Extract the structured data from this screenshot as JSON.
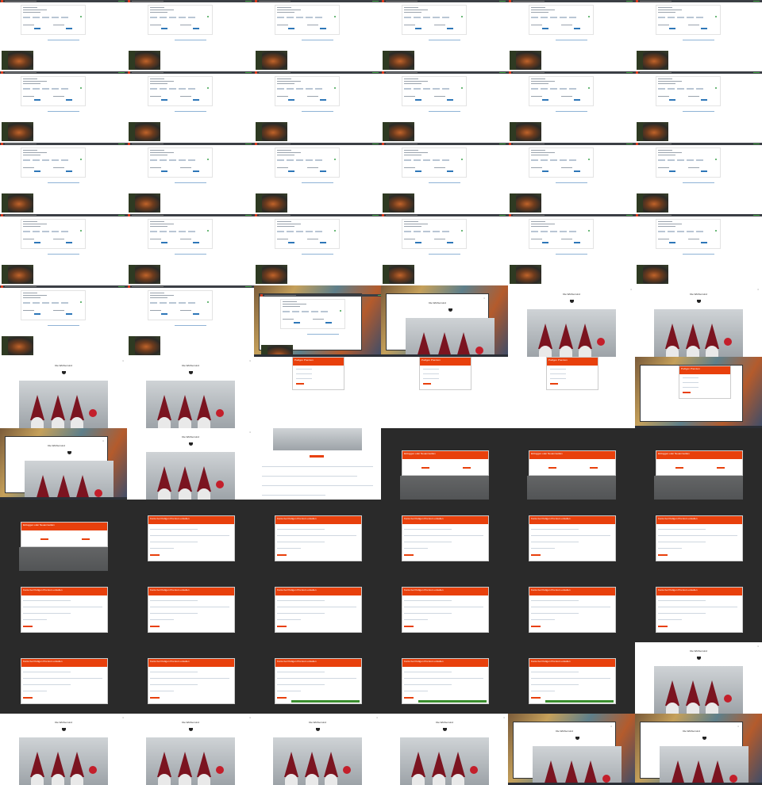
{
  "grid": {
    "cols": 6,
    "rows": 11
  },
  "labels": {
    "gnome_title": "Die Wichtel sind",
    "gnome_sub": "",
    "form_title": "Podigon Premium",
    "orange_header_1": "Einloggen oder Neuanmelden",
    "orange_header_2": "Konto bei Podigon Premium erstellen"
  },
  "colors": {
    "accent_orange": "#e8400c",
    "button_blue": "#2e77b8",
    "ok_green": "#3ea34f",
    "bar_dark": "#3b3f45",
    "bg_dark": "#2a2a2a"
  },
  "cells": [
    {
      "type": "form"
    },
    {
      "type": "form"
    },
    {
      "type": "form"
    },
    {
      "type": "form"
    },
    {
      "type": "form"
    },
    {
      "type": "form"
    },
    {
      "type": "form"
    },
    {
      "type": "form"
    },
    {
      "type": "form"
    },
    {
      "type": "form"
    },
    {
      "type": "form"
    },
    {
      "type": "form"
    },
    {
      "type": "form"
    },
    {
      "type": "form"
    },
    {
      "type": "form"
    },
    {
      "type": "form"
    },
    {
      "type": "form"
    },
    {
      "type": "form"
    },
    {
      "type": "form"
    },
    {
      "type": "form"
    },
    {
      "type": "form"
    },
    {
      "type": "form"
    },
    {
      "type": "form"
    },
    {
      "type": "form"
    },
    {
      "type": "form"
    },
    {
      "type": "form"
    },
    {
      "type": "desktop_form"
    },
    {
      "type": "desktop_gnome"
    },
    {
      "type": "gnome"
    },
    {
      "type": "gnome"
    },
    {
      "type": "gnome"
    },
    {
      "type": "gnome"
    },
    {
      "type": "login"
    },
    {
      "type": "login"
    },
    {
      "type": "login"
    },
    {
      "type": "desktop_login"
    },
    {
      "type": "desktop_gnome"
    },
    {
      "type": "gnome"
    },
    {
      "type": "podcast_page"
    },
    {
      "type": "dark_choice"
    },
    {
      "type": "dark_choice"
    },
    {
      "type": "dark_choice"
    },
    {
      "type": "dark_choice"
    },
    {
      "type": "dark_signup"
    },
    {
      "type": "dark_signup"
    },
    {
      "type": "dark_signup"
    },
    {
      "type": "dark_signup"
    },
    {
      "type": "dark_signup"
    },
    {
      "type": "dark_signup"
    },
    {
      "type": "dark_signup"
    },
    {
      "type": "dark_signup"
    },
    {
      "type": "dark_signup"
    },
    {
      "type": "dark_signup"
    },
    {
      "type": "dark_signup"
    },
    {
      "type": "dark_signup"
    },
    {
      "type": "dark_signup"
    },
    {
      "type": "dark_signup_green"
    },
    {
      "type": "dark_signup_green"
    },
    {
      "type": "dark_signup_green"
    },
    {
      "type": "gnome"
    },
    {
      "type": "gnome"
    },
    {
      "type": "gnome"
    },
    {
      "type": "gnome"
    },
    {
      "type": "gnome"
    },
    {
      "type": "desktop_gnome"
    },
    {
      "type": "desktop_gnome"
    }
  ]
}
